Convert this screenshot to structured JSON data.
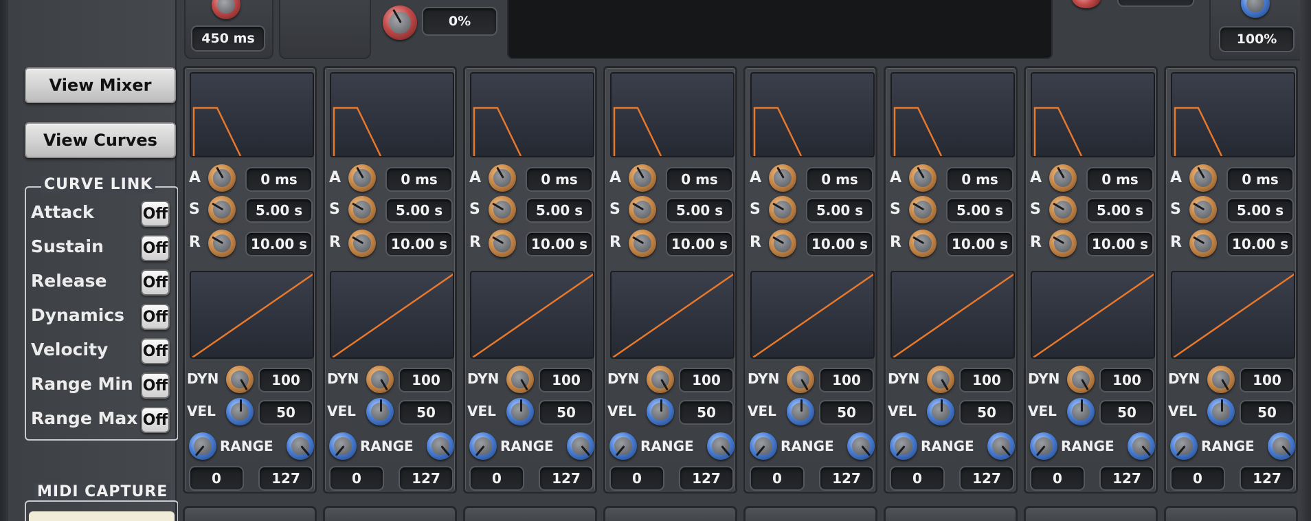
{
  "top": {
    "time_value": "450 ms",
    "percent_left": "0%",
    "percent_right": "100%"
  },
  "sidebar": {
    "view_mixer": "View Mixer",
    "view_curves": "View Curves",
    "curve_link": {
      "title": "CURVE LINK",
      "items": [
        {
          "label": "Attack",
          "state": "Off"
        },
        {
          "label": "Sustain",
          "state": "Off"
        },
        {
          "label": "Release",
          "state": "Off"
        },
        {
          "label": "Dynamics",
          "state": "Off"
        },
        {
          "label": "Velocity",
          "state": "Off"
        },
        {
          "label": "Range Min",
          "state": "Off"
        },
        {
          "label": "Range Max",
          "state": "Off"
        }
      ]
    },
    "midi_capture_title": "MIDI CAPTURE"
  },
  "channel_labels": {
    "attack": "A",
    "sustain": "S",
    "release": "R",
    "dyn": "DYN",
    "vel": "VEL",
    "range": "RANGE"
  },
  "channels": [
    {
      "attack": "0 ms",
      "sustain": "5.00 s",
      "release": "10.00 s",
      "dyn": "100",
      "vel": "50",
      "range_min": "0",
      "range_max": "127"
    },
    {
      "attack": "0 ms",
      "sustain": "5.00 s",
      "release": "10.00 s",
      "dyn": "100",
      "vel": "50",
      "range_min": "0",
      "range_max": "127"
    },
    {
      "attack": "0 ms",
      "sustain": "5.00 s",
      "release": "10.00 s",
      "dyn": "100",
      "vel": "50",
      "range_min": "0",
      "range_max": "127"
    },
    {
      "attack": "0 ms",
      "sustain": "5.00 s",
      "release": "10.00 s",
      "dyn": "100",
      "vel": "50",
      "range_min": "0",
      "range_max": "127"
    },
    {
      "attack": "0 ms",
      "sustain": "5.00 s",
      "release": "10.00 s",
      "dyn": "100",
      "vel": "50",
      "range_min": "0",
      "range_max": "127"
    },
    {
      "attack": "0 ms",
      "sustain": "5.00 s",
      "release": "10.00 s",
      "dyn": "100",
      "vel": "50",
      "range_min": "0",
      "range_max": "127"
    },
    {
      "attack": "0 ms",
      "sustain": "5.00 s",
      "release": "10.00 s",
      "dyn": "100",
      "vel": "50",
      "range_min": "0",
      "range_max": "127"
    },
    {
      "attack": "0 ms",
      "sustain": "5.00 s",
      "release": "10.00 s",
      "dyn": "100",
      "vel": "50",
      "range_min": "0",
      "range_max": "127"
    }
  ],
  "colors": {
    "curve": "#e8782c",
    "knob_orange": "#c98a4a",
    "knob_blue": "#4a7fd6",
    "knob_red": "#c24a4a"
  }
}
